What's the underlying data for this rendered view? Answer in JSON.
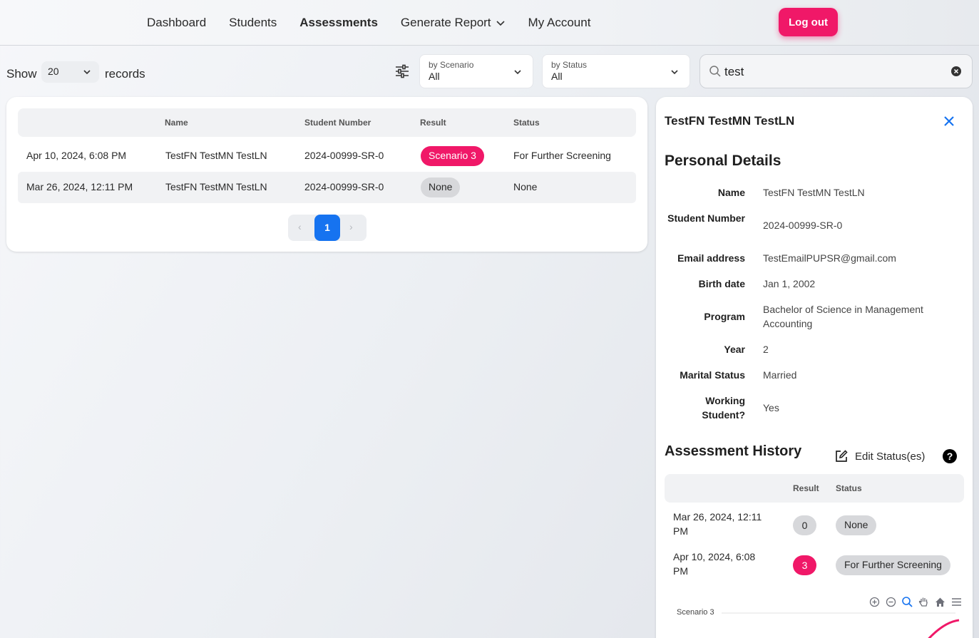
{
  "nav": {
    "items": [
      {
        "label": "Dashboard",
        "active": false
      },
      {
        "label": "Students",
        "active": false
      },
      {
        "label": "Assessments",
        "active": true
      },
      {
        "label": "Generate Report",
        "active": false,
        "dropdown": true
      },
      {
        "label": "My Account",
        "active": false
      }
    ],
    "logout_label": "Log out"
  },
  "filters": {
    "show_label": "Show",
    "records_label": "records",
    "page_size": "20",
    "scenario": {
      "caption": "by Scenario",
      "value": "All"
    },
    "status": {
      "caption": "by Status",
      "value": "All"
    },
    "search_value": "test",
    "icons": {
      "filter": "sliders-icon",
      "search": "search-icon",
      "clear": "clear-circle-icon"
    }
  },
  "table": {
    "columns": [
      "",
      "Name",
      "Student Number",
      "Result",
      "Status"
    ],
    "rows": [
      {
        "date": "Apr 10, 2024, 6:08 PM",
        "name": "TestFN TestMN TestLN",
        "student_number": "2024-00999-SR-0",
        "result": "Scenario 3",
        "result_color": "#f01868",
        "status": "For Further Screening"
      },
      {
        "date": "Mar 26, 2024, 12:11 PM",
        "name": "TestFN TestMN TestLN",
        "student_number": "2024-00999-SR-0",
        "result": "None",
        "result_color": "#d7d8db",
        "status": "None"
      }
    ],
    "pagination": {
      "prev": "‹",
      "current": "1",
      "next": "›"
    }
  },
  "panel": {
    "title": "TestFN TestMN TestLN",
    "personal_heading": "Personal Details",
    "details": [
      {
        "label": "Name",
        "value": "TestFN TestMN TestLN"
      },
      {
        "label": "Student Number",
        "value": "2024-00999-SR-0"
      },
      {
        "label": "Email address",
        "value": "TestEmailPUPSR@gmail.com"
      },
      {
        "label": "Birth date",
        "value": "Jan 1, 2002"
      },
      {
        "label": "Program",
        "value": "Bachelor of Science in Management Accounting"
      },
      {
        "label": "Year",
        "value": "2"
      },
      {
        "label": "Marital Status",
        "value": "Married"
      },
      {
        "label": "Working Student?",
        "value": "Yes"
      }
    ],
    "history_heading": "Assessment History",
    "edit_label": "Edit Status(es)",
    "history_columns": [
      "",
      "Result",
      "Status"
    ],
    "history": [
      {
        "date": "Mar 26, 2024, 12:11 PM",
        "result": "0",
        "status": "None"
      },
      {
        "date": "Apr 10, 2024, 6:08 PM",
        "result": "3",
        "status": "For Further Screening"
      }
    ],
    "chart_series_label": "Scenario 3"
  },
  "colors": {
    "accent": "#f01868",
    "primary": "#1673f0"
  }
}
